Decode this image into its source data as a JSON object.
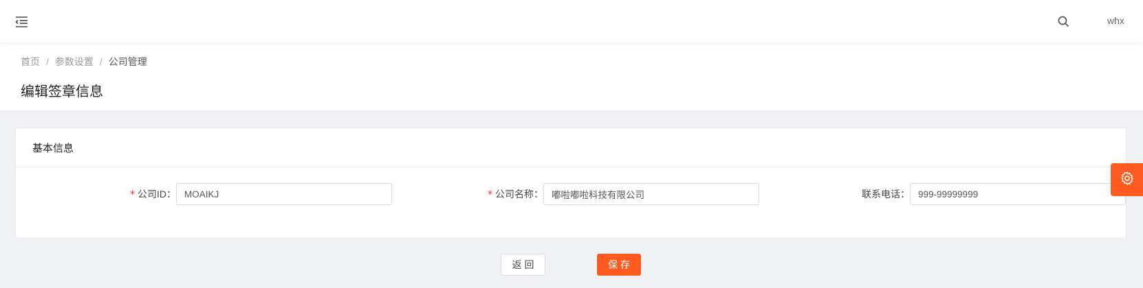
{
  "topbar": {
    "menu_icon": "menu-fold-icon",
    "search_icon": "search-icon",
    "username": "whx"
  },
  "breadcrumb": {
    "items": [
      "首页",
      "参数设置",
      "公司管理"
    ],
    "separator": "/"
  },
  "page": {
    "title": "编辑签章信息"
  },
  "card": {
    "title": "基本信息"
  },
  "form": {
    "company_id": {
      "label": "公司ID：",
      "required": true,
      "value": "MOAIKJ"
    },
    "company_name": {
      "label": "公司名称：",
      "required": true,
      "value": "嘟啦嘟啦科技有限公司"
    },
    "phone": {
      "label": "联系电话：",
      "required": false,
      "value": "999-99999999"
    },
    "required_mark": "*"
  },
  "buttons": {
    "back_label": "返回",
    "save_label": "保存"
  },
  "floating": {
    "settings_icon": "gear-icon"
  },
  "colors": {
    "accent": "#ff5a1f",
    "required": "#f5222d",
    "background": "#f0f2f5"
  }
}
